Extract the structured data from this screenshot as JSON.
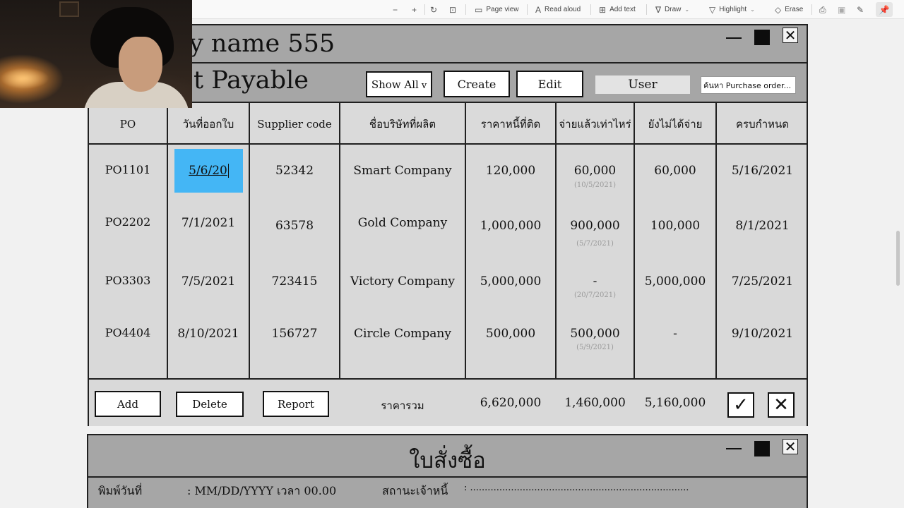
{
  "viewer_toolbar": {
    "zoom_out_icon": "minus-icon",
    "zoom_in_icon": "plus-icon",
    "rotate_icon": "rotate-icon",
    "fit_icon": "fit-page-icon",
    "page_view": "Page view",
    "read_aloud": "Read aloud",
    "add_text": "Add text",
    "draw": "Draw",
    "highlight": "Highlight",
    "erase": "Erase"
  },
  "main_window": {
    "title_top": "y name 555",
    "title_bottom": "t Payable",
    "show_all": "Show All",
    "create": "Create",
    "edit": "Edit",
    "user": "User",
    "search_placeholder": "ค้นหา Purchase order..."
  },
  "table": {
    "columns": [
      "PO",
      "วันที่ออกใบ",
      "Supplier code",
      "ชื่อบริษัทที่ผลิต",
      "ราคาหนี้ที่ติด",
      "จ่ายแล้วเท่าไหร่",
      "ยังไม่ได้จ่าย",
      "ครบกำหนด"
    ],
    "rows": [
      {
        "po": "PO1101",
        "date": "5/6/20",
        "supplier": "52342",
        "company": "Smart Company",
        "debt": "120,000",
        "paid": "60,000",
        "paid_date": "(10/5/2021)",
        "unpaid": "60,000",
        "due": "5/16/2021"
      },
      {
        "po": "PO2202",
        "date": "7/1/2021",
        "supplier": "63578",
        "company": "Gold Company",
        "debt": "1,000,000",
        "paid": "900,000",
        "paid_date": "(5/7/2021)",
        "unpaid": "100,000",
        "due": "8/1/2021"
      },
      {
        "po": "PO3303",
        "date": "7/5/2021",
        "supplier": "723415",
        "company": "Victory Company",
        "debt": "5,000,000",
        "paid": "-",
        "paid_date": "(20/7/2021)",
        "unpaid": "5,000,000",
        "due": "7/25/2021"
      },
      {
        "po": "PO4404",
        "date": "8/10/2021",
        "supplier": "156727",
        "company": "Circle Company",
        "debt": "500,000",
        "paid": "500,000",
        "paid_date": "(5/9/2021)",
        "unpaid": "-",
        "due": "9/10/2021"
      }
    ],
    "footer": {
      "add": "Add",
      "delete": "Delete",
      "report": "Report",
      "total_label": "ราคารวม",
      "total_debt": "6,620,000",
      "total_paid": "1,460,000",
      "total_unpaid": "5,160,000"
    }
  },
  "po_window": {
    "title": "ใบสั่งซื้อ",
    "print_date_label": "พิมพ์วันที่",
    "print_date_value": ": MM/DD/YYYY เวลา 00.00",
    "creditor_status_label": "สถานะเจ้าหนี้",
    "creditor_status_value": ": ..........................................................................."
  }
}
